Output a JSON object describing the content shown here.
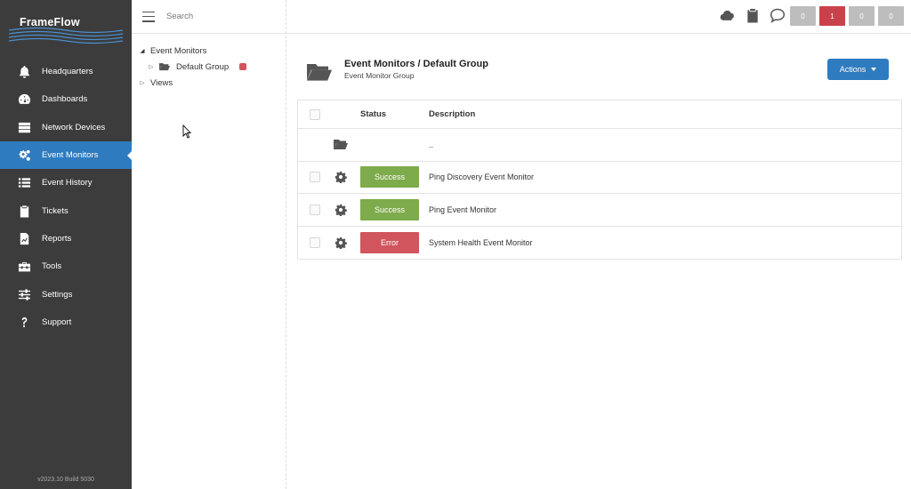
{
  "app": {
    "name": "FrameFlow",
    "version": "v2023.10 Build 5030"
  },
  "sidebar": {
    "items": [
      {
        "label": "Headquarters",
        "icon": "bell-icon"
      },
      {
        "label": "Dashboards",
        "icon": "gauge-icon"
      },
      {
        "label": "Network Devices",
        "icon": "server-icon"
      },
      {
        "label": "Event Monitors",
        "icon": "gears-icon",
        "active": true
      },
      {
        "label": "Event History",
        "icon": "list-icon"
      },
      {
        "label": "Tickets",
        "icon": "clipboard-icon"
      },
      {
        "label": "Reports",
        "icon": "report-icon"
      },
      {
        "label": "Tools",
        "icon": "toolbox-icon"
      },
      {
        "label": "Settings",
        "icon": "sliders-icon"
      },
      {
        "label": "Support",
        "icon": "question-icon"
      }
    ]
  },
  "tree": {
    "search_placeholder": "Search",
    "root_label": "Event Monitors",
    "group_label": "Default Group",
    "views_label": "Views"
  },
  "topbar": {
    "icons": [
      "cloud-icon",
      "clipboard-icon",
      "chat-icon"
    ],
    "counts": [
      "0",
      "1",
      "0",
      "0"
    ]
  },
  "main": {
    "title": "Event Monitors / Default Group",
    "subtitle": "Event Monitor Group",
    "actions_label": "Actions",
    "columns": {
      "status": "Status",
      "description": "Description"
    },
    "parent_row_label": "..",
    "rows": [
      {
        "status": "Success",
        "description": "Ping Discovery Event Monitor"
      },
      {
        "status": "Success",
        "description": "Ping Event Monitor"
      },
      {
        "status": "Error",
        "description": "System Health Event Monitor"
      }
    ]
  },
  "colors": {
    "sidebar_bg": "#3c3c3c",
    "accent": "#2f7bbf",
    "success": "#7eab4b",
    "error": "#d0555d"
  }
}
